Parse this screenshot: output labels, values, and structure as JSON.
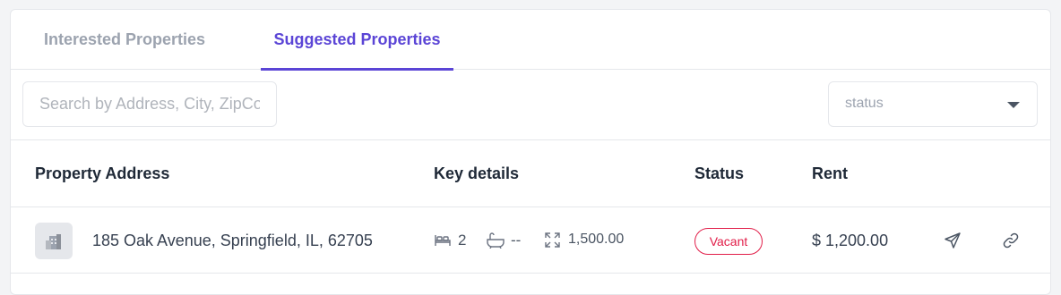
{
  "tabs": [
    {
      "label": "Interested Properties",
      "active": false
    },
    {
      "label": "Suggested Properties",
      "active": true
    }
  ],
  "search": {
    "placeholder": "Search by Address, City, ZipCode",
    "value": ""
  },
  "status_filter": {
    "value": "status"
  },
  "table": {
    "headers": [
      "Property Address",
      "Key details",
      "Status",
      "Rent"
    ],
    "rows": [
      {
        "address": "185 Oak Avenue, Springfield, IL, 62705",
        "beds": "2",
        "baths": "--",
        "area": "1,500.00",
        "status": "Vacant",
        "rent": "$ 1,200.00"
      }
    ]
  },
  "colors": {
    "accent": "#5b45d6",
    "vacant": "#e11d48"
  },
  "icons": [
    "building-icon",
    "bed-icon",
    "bath-icon",
    "expand-icon",
    "send-icon",
    "link-icon",
    "chevron-down-icon"
  ]
}
